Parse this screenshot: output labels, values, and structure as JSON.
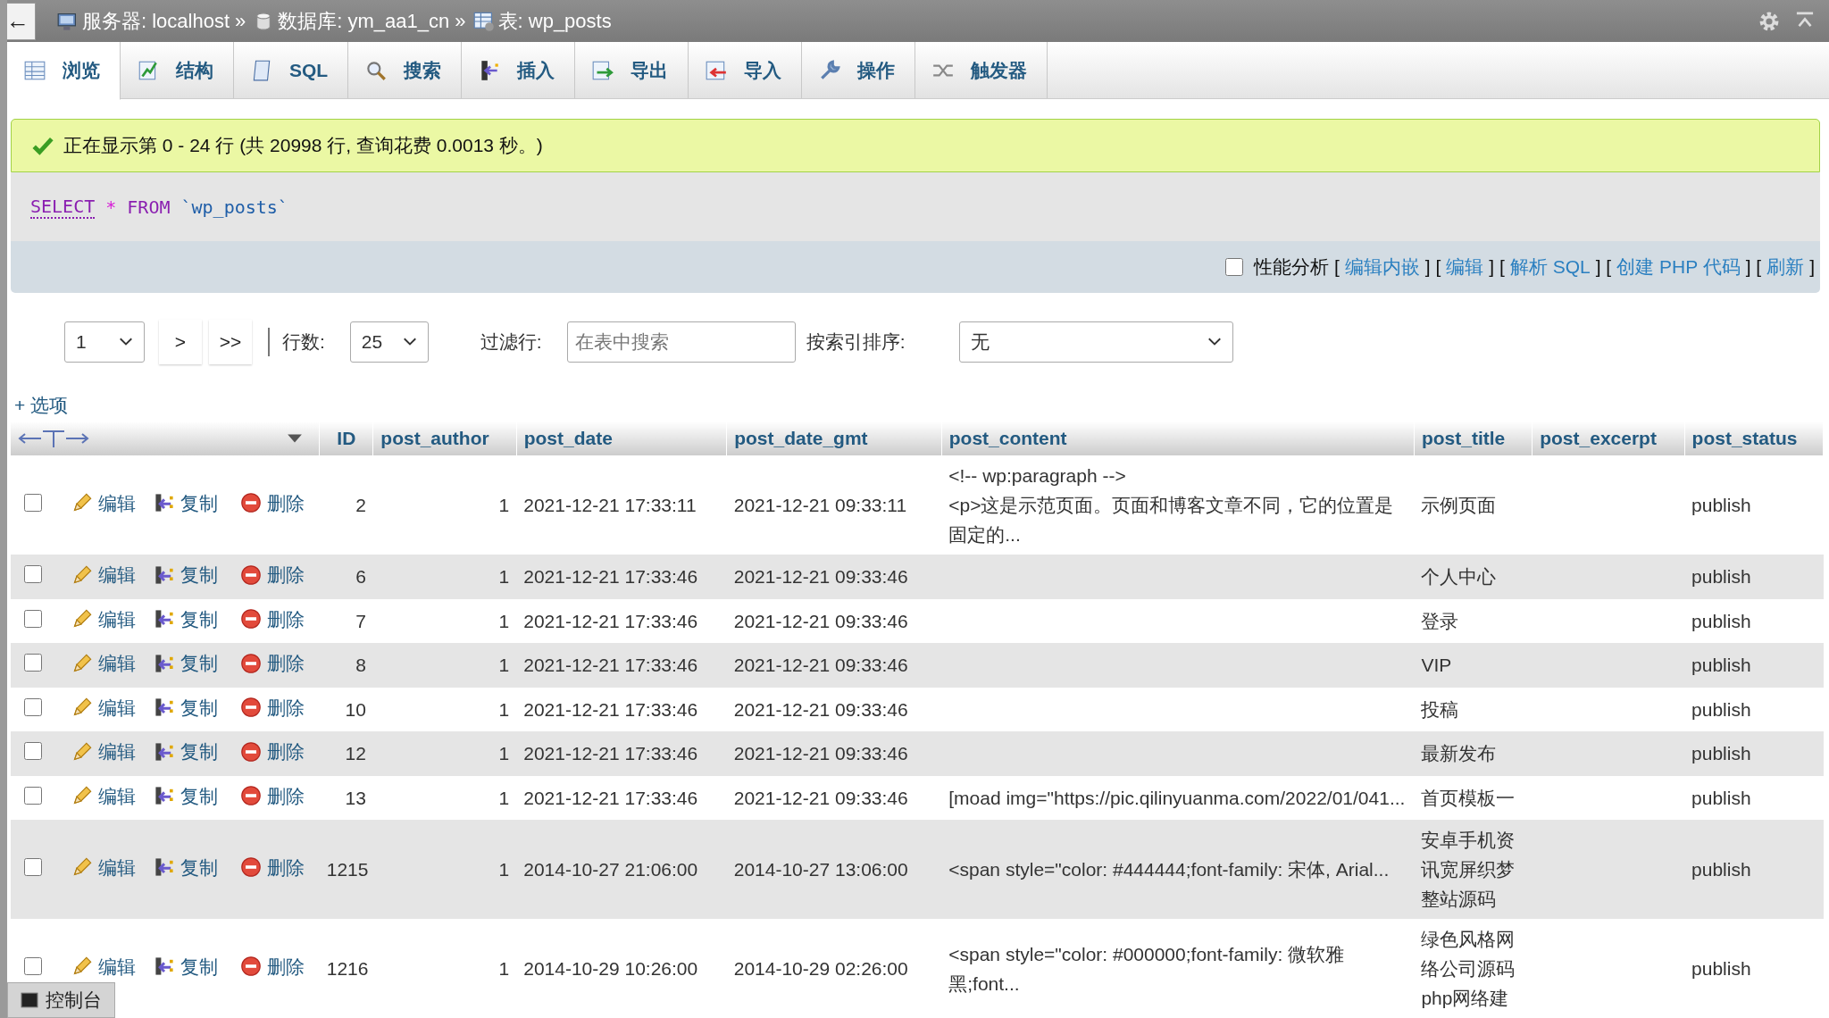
{
  "breadcrumb": [
    {
      "kind": "server",
      "text": "服务器: localhost"
    },
    {
      "kind": "database",
      "text": "数据库: ym_aa1_cn"
    },
    {
      "kind": "table",
      "text": "表: wp_posts"
    }
  ],
  "breadcrumb_separator": "»",
  "back_button": "←",
  "tabs": [
    {
      "kind": "browse",
      "label": "浏览",
      "selected": true
    },
    {
      "kind": "structure",
      "label": "结构",
      "selected": false
    },
    {
      "kind": "sql",
      "label": "SQL",
      "selected": false
    },
    {
      "kind": "search",
      "label": "搜索",
      "selected": false
    },
    {
      "kind": "insert",
      "label": "插入",
      "selected": false
    },
    {
      "kind": "export",
      "label": "导出",
      "selected": false
    },
    {
      "kind": "import",
      "label": "导入",
      "selected": false
    },
    {
      "kind": "operations",
      "label": "操作",
      "selected": false
    },
    {
      "kind": "triggers",
      "label": "触发器",
      "selected": false
    }
  ],
  "message": "正在显示第 0 - 24 行 (共 20998 行, 查询花费 0.0013 秒。)",
  "sql_tokens": [
    {
      "kind": "keyword",
      "text": "SELECT"
    },
    {
      "kind": "operator",
      "text": "*"
    },
    {
      "kind": "keyword",
      "text": "FROM"
    },
    {
      "kind": "identifier",
      "text": "`wp_posts`"
    }
  ],
  "profiling": {
    "label": "性能分析",
    "checked": false
  },
  "query_links": [
    {
      "kind": "text",
      "text": "["
    },
    {
      "kind": "link",
      "text": "编辑内嵌"
    },
    {
      "kind": "text",
      "text": "] ["
    },
    {
      "kind": "link",
      "text": "编辑"
    },
    {
      "kind": "text",
      "text": "] ["
    },
    {
      "kind": "link",
      "text": "解析 SQL"
    },
    {
      "kind": "text",
      "text": "] ["
    },
    {
      "kind": "link",
      "text": "创建 PHP 代码"
    },
    {
      "kind": "text",
      "text": "] ["
    },
    {
      "kind": "link",
      "text": "刷新"
    },
    {
      "kind": "text",
      "text": "]"
    }
  ],
  "navigation": {
    "page": "1",
    "next": ">",
    "last": ">>",
    "rows_label": "行数:",
    "rows": "25",
    "filter_label": "过滤行:",
    "filter_placeholder": "在表中搜索",
    "sort_label": "按索引排序:",
    "sort": "无"
  },
  "options_link": "+ 选项",
  "columns": [
    "ID",
    "post_author",
    "post_date",
    "post_date_gmt",
    "post_content",
    "post_title",
    "post_excerpt",
    "post_status"
  ],
  "rows": [
    {
      "checked": false,
      "edit": "编辑",
      "copy": "复制",
      "delete": "删除",
      "cells": [
        "2",
        "1",
        "2021-12-21 17:33:11",
        "2021-12-21 09:33:11",
        "<!-- wp:paragraph -->\n<p>这是示范页面。页面和博客文章不同，它的位置是固定的...",
        "示例页面",
        "",
        "publish"
      ]
    },
    {
      "checked": false,
      "edit": "编辑",
      "copy": "复制",
      "delete": "删除",
      "cells": [
        "6",
        "1",
        "2021-12-21 17:33:46",
        "2021-12-21 09:33:46",
        "",
        "个人中心",
        "",
        "publish"
      ]
    },
    {
      "checked": false,
      "edit": "编辑",
      "copy": "复制",
      "delete": "删除",
      "cells": [
        "7",
        "1",
        "2021-12-21 17:33:46",
        "2021-12-21 09:33:46",
        "",
        "登录",
        "",
        "publish"
      ]
    },
    {
      "checked": false,
      "edit": "编辑",
      "copy": "复制",
      "delete": "删除",
      "cells": [
        "8",
        "1",
        "2021-12-21 17:33:46",
        "2021-12-21 09:33:46",
        "",
        "VIP",
        "",
        "publish"
      ]
    },
    {
      "checked": false,
      "edit": "编辑",
      "copy": "复制",
      "delete": "删除",
      "cells": [
        "10",
        "1",
        "2021-12-21 17:33:46",
        "2021-12-21 09:33:46",
        "",
        "投稿",
        "",
        "publish"
      ]
    },
    {
      "checked": false,
      "edit": "编辑",
      "copy": "复制",
      "delete": "删除",
      "cells": [
        "12",
        "1",
        "2021-12-21 17:33:46",
        "2021-12-21 09:33:46",
        "",
        "最新发布",
        "",
        "publish"
      ]
    },
    {
      "checked": false,
      "edit": "编辑",
      "copy": "复制",
      "delete": "删除",
      "cells": [
        "13",
        "1",
        "2021-12-21 17:33:46",
        "2021-12-21 09:33:46",
        "[moad img=\"https://pic.qilinyuanma.com/2022/01/041...",
        "首页模板一",
        "",
        "publish"
      ]
    },
    {
      "checked": false,
      "edit": "编辑",
      "copy": "复制",
      "delete": "删除",
      "cells": [
        "1215",
        "1",
        "2014-10-27 21:06:00",
        "2014-10-27 13:06:00",
        "<span style=\"color: #444444;font-family: 宋体, Arial...",
        "安卓手机资讯宽屏织梦整站源码",
        "",
        "publish"
      ]
    },
    {
      "checked": false,
      "edit": "编辑",
      "copy": "复制",
      "delete": "删除",
      "cells": [
        "1216",
        "1",
        "2014-10-29 10:26:00",
        "2014-10-29 02:26:00",
        "<span style=\"color: #000000;font-family: 微软雅黑;font...",
        "绿色风格网络公司源码php网络建",
        "",
        "publish"
      ]
    }
  ],
  "console_button": "控制台"
}
